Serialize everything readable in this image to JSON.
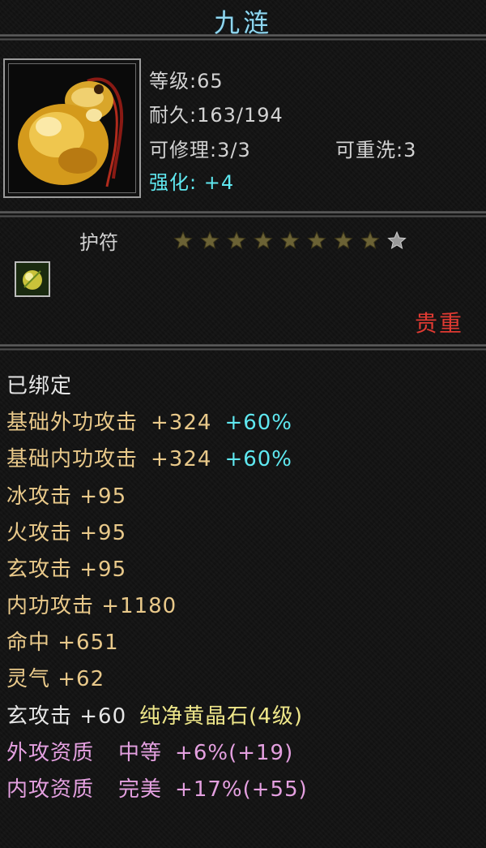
{
  "item": {
    "name": "九涟",
    "level": "等级:65",
    "durability": "耐久:163/194",
    "repairable": "可修理:3/3",
    "rewash": "可重洗:3",
    "enhance": "强化: +4",
    "type": "护符",
    "stars_filled": 8,
    "stars_total": 9,
    "rarity": "贵重"
  },
  "colors": {
    "title": "#8fd6ef",
    "rarity": "#e03a32",
    "attr_gold": "#e9c98a",
    "attr_cyan": "#5fe8f0",
    "gem_yellow": "#efe78a",
    "quality_pink": "#e4a0e0"
  },
  "attributes": {
    "bound": "已绑定",
    "base_outer_label": "基础外功攻击",
    "base_outer_value": "+324",
    "base_outer_pct": "+60%",
    "base_inner_label": "基础内功攻击",
    "base_inner_value": "+324",
    "base_inner_pct": "+60%",
    "ice": "冰攻击  +95",
    "fire": "火攻击  +95",
    "xuan": "玄攻击  +95",
    "inner": "内功攻击  +1180",
    "hit": "命中  +651",
    "spirit": "灵气  +62",
    "gem_stat": "玄攻击  +60",
    "gem_name": "纯净黄晶石(4级)",
    "outer_quality_label": "外攻资质",
    "outer_quality_grade": "中等",
    "outer_quality_value": "+6%(+19)",
    "inner_quality_label": "内攻资质",
    "inner_quality_grade": "完美",
    "inner_quality_value": "+17%(+55)"
  },
  "icons": {
    "item": "jade-gourd-icon",
    "slot": "gem-slot-icon",
    "star": "star-icon"
  }
}
